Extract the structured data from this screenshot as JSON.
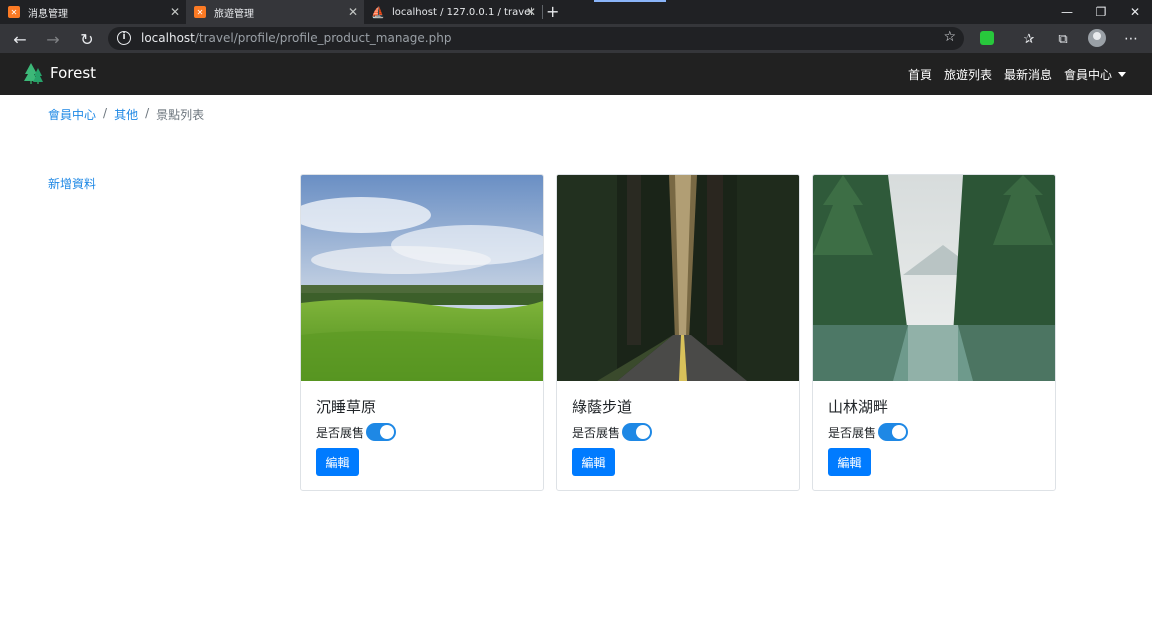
{
  "browser": {
    "tabs": [
      {
        "title": "消息管理",
        "favicon": "xampp-icon"
      },
      {
        "title": "旅遊管理",
        "favicon": "xampp-icon"
      },
      {
        "title": "localhost / 127.0.0.1 / travel / tra",
        "favicon": "phpmyadmin-icon"
      }
    ],
    "url_host": "localhost",
    "url_path": "/travel/profile/profile_product_manage.php"
  },
  "navbar": {
    "brand": "Forest",
    "links": [
      "首頁",
      "旅遊列表",
      "最新消息",
      "會員中心"
    ]
  },
  "breadcrumb": [
    "會員中心",
    "其他",
    "景點列表"
  ],
  "sidebar": {
    "add_link": "新增資料"
  },
  "cards": [
    {
      "title": "沉睡草原",
      "toggle_label": "是否展售",
      "on_sale": true,
      "edit_label": "編輯"
    },
    {
      "title": "綠蔭步道",
      "toggle_label": "是否展售",
      "on_sale": true,
      "edit_label": "編輯"
    },
    {
      "title": "山林湖畔",
      "toggle_label": "是否展售",
      "on_sale": true,
      "edit_label": "編輯"
    }
  ],
  "colors": {
    "link": "#1e88e5",
    "button": "#007bff",
    "navbar": "#212121"
  }
}
